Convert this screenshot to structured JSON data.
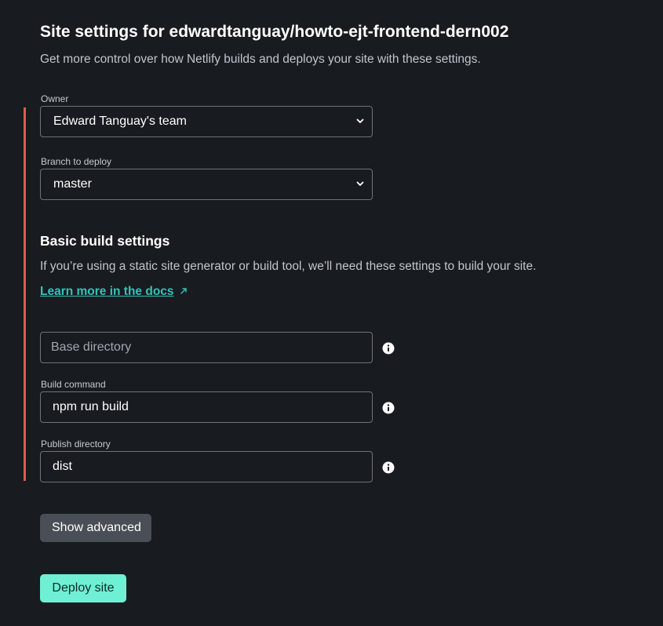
{
  "header": {
    "title": "Site settings for edwardtanguay/howto-ejt-frontend-dern002",
    "subtitle": "Get more control over how Netlify builds and deploys your site with these settings."
  },
  "owner": {
    "label": "Owner",
    "value": "Edward Tanguay's team"
  },
  "branch": {
    "label": "Branch to deploy",
    "value": "master"
  },
  "build_settings": {
    "title": "Basic build settings",
    "description": "If you’re using a static site generator or build tool, we’ll need these settings to build your site.",
    "docs_link": "Learn more in the docs",
    "docs_link_icon": "external-link-icon",
    "base_directory": {
      "placeholder": "Base directory",
      "value": ""
    },
    "build_command": {
      "label": "Build command",
      "value": "npm run build"
    },
    "publish_directory": {
      "label": "Publish directory",
      "value": "dist"
    },
    "info_icon": "info-icon"
  },
  "actions": {
    "show_advanced": "Show advanced",
    "deploy": "Deploy site"
  },
  "colors": {
    "background": "#181b20",
    "accent_bar": "#e35a4f",
    "link": "#32c5b8",
    "deploy_button": "#6ff0d4",
    "secondary_button": "#4a4f57"
  }
}
